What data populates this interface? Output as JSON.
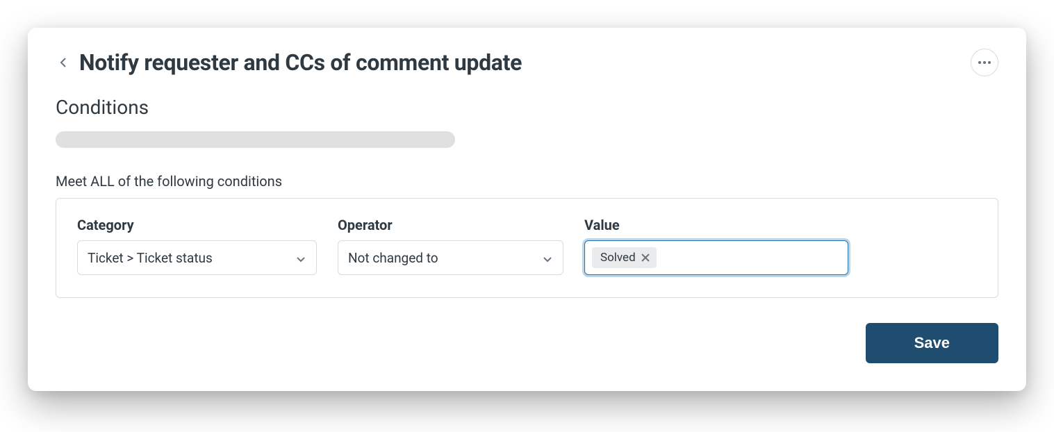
{
  "header": {
    "title": "Notify requester and CCs of comment update"
  },
  "section": {
    "title": "Conditions",
    "meetAllLabel": "Meet ALL of the following conditions"
  },
  "condition": {
    "categoryLabel": "Category",
    "operatorLabel": "Operator",
    "valueLabel": "Value",
    "categoryValue": "Ticket > Ticket status",
    "operatorValue": "Not changed to",
    "valueTag": "Solved"
  },
  "actions": {
    "saveLabel": "Save"
  }
}
